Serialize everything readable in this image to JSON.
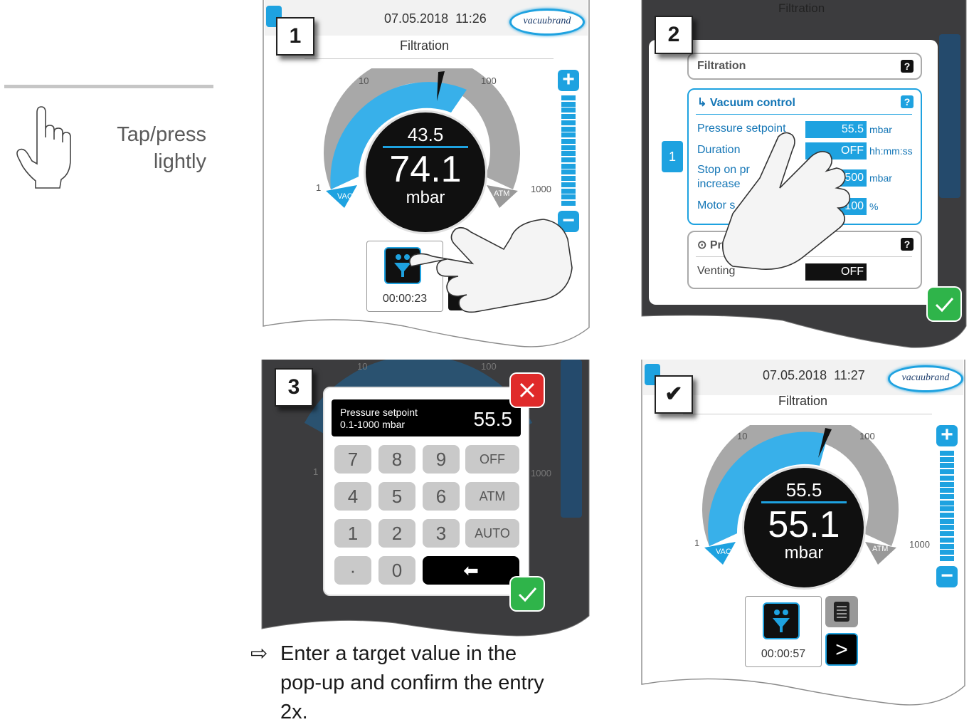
{
  "legend": {
    "icon": "tap-hand-icon",
    "text_line1": "Tap/press",
    "text_line2": "lightly"
  },
  "step1": {
    "number": "1",
    "date": "07.05.2018",
    "time": "11:26",
    "logo": "vacuubrand",
    "title": "Filtration",
    "scale": {
      "min": "1",
      "t10": "10",
      "t100": "100",
      "max": "1000",
      "vac": "VAC",
      "atm": "ATM"
    },
    "setpoint": "43.5",
    "pressure": "74.1",
    "unit": "mbar",
    "tile_time": "00:00:23",
    "fill_fraction": 0.55
  },
  "step2": {
    "number": "2",
    "bg_title": "Filtration",
    "page_indicator": "1",
    "section1_title": "Filtration",
    "section2_title": "Vacuum control",
    "rows": [
      {
        "label": "Pressure setpoint",
        "value": "55.5",
        "unit": "mbar"
      },
      {
        "label": "Duration",
        "value": "OFF",
        "unit": "hh:mm:ss"
      },
      {
        "label": "Stop on pr",
        "label2": "increase",
        "value": "500",
        "unit": "mbar"
      },
      {
        "label": "Motor s",
        "value": "100",
        "unit": "%"
      }
    ],
    "section3_title": "Pro",
    "venting_label": "Venting",
    "venting_value": "OFF",
    "help": "?"
  },
  "step3": {
    "number": "3",
    "display_label1": "Pressure setpoint",
    "display_label2": "0.1-1000 mbar",
    "display_value": "55.5",
    "keys": [
      [
        "7",
        "8",
        "9",
        "OFF"
      ],
      [
        "4",
        "5",
        "6",
        "ATM"
      ],
      [
        "1",
        "2",
        "3",
        "AUTO"
      ],
      [
        "·",
        "0",
        "⬅"
      ]
    ],
    "bg_ticks": {
      "t10": "10",
      "t100": "100",
      "min": "1",
      "max": "1000"
    }
  },
  "step4": {
    "number": "✔",
    "date": "07.05.2018",
    "time": "11:27",
    "logo": "vacuubrand",
    "title": "Filtration",
    "scale": {
      "min": "1",
      "t10": "10",
      "t100": "100",
      "max": "1000",
      "vac": "VAC",
      "atm": "ATM"
    },
    "setpoint": "55.5",
    "pressure": "55.1",
    "unit": "mbar",
    "tile_time": "00:00:57",
    "next": ">",
    "fill_fraction": 0.5
  },
  "caption": {
    "arrow": "⇨",
    "line1": "Enter a target value in the",
    "line2": "pop-up and confirm the entry",
    "line3": "2x."
  },
  "colors": {
    "accent": "#1ea2e0",
    "ok": "#2fb44a",
    "cancel": "#e02a2a",
    "dark_bg": "#3c3c3e"
  }
}
